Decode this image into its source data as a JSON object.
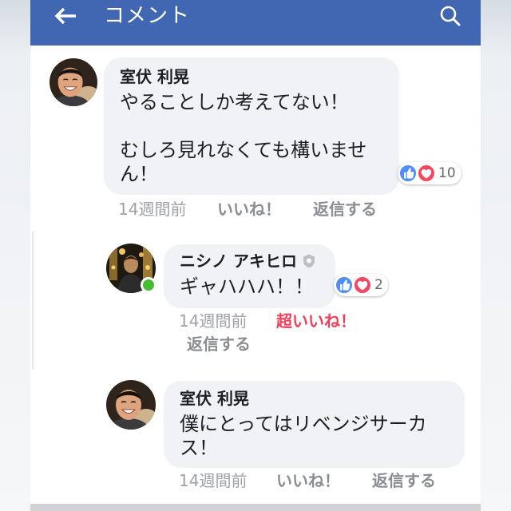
{
  "header": {
    "title": "コメント",
    "back_icon": "arrow-left-icon",
    "search_icon": "search-icon"
  },
  "comments": [
    {
      "author": "室伏 利晃",
      "paragraphs": [
        [
          "やることしか考えてない！"
        ],
        [
          "むしろ見れなくても構いませ",
          "ん！"
        ]
      ],
      "reactions": {
        "icons": [
          "like-icon",
          "love-icon"
        ],
        "count": 10
      },
      "time": "14週間前",
      "like_label": "いいね！",
      "reply_label": "返信する",
      "replies": [
        {
          "author": "ニシノ アキヒロ",
          "author_badge_icon": "shield-badge-icon",
          "online": true,
          "paragraphs": [
            [
              "ギャハハハ！！"
            ]
          ],
          "reactions": {
            "icons": [
              "like-icon",
              "love-icon"
            ],
            "count": 2
          },
          "time": "14週間前",
          "reaction_label": "超いいね！",
          "reply_label": "返信する"
        },
        {
          "author": "室伏 利晃",
          "paragraphs": [
            [
              "僕にとってはリベンジサーカ",
              "ス！"
            ]
          ],
          "time": "14週間前",
          "like_label": "いいね！",
          "reply_label": "返信する"
        }
      ]
    }
  ],
  "colors": {
    "header": "#4267b2",
    "bubble": "#f0f2f5",
    "text": "#1c1e21",
    "meta_time": "#9ea2a8",
    "meta_action": "#8a8d91",
    "love_label": "#f33e58",
    "like_icon": "#4f8df7",
    "love_icon": "#f2475f",
    "online_dot": "#44bd32",
    "thread_line": "#e4e6eb",
    "bottom_bar": "#cfd3d8"
  }
}
